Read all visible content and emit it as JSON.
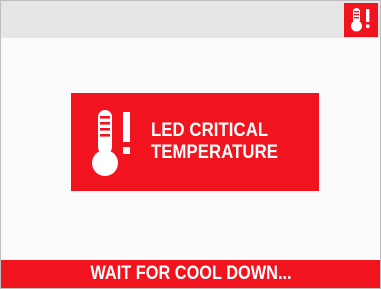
{
  "colors": {
    "alert_red": "#f1141e",
    "topbar_gray": "#e6e6e6",
    "background": "#fbfbfb",
    "text_white": "#ffffff"
  },
  "status_bar": {
    "icon": "thermometer-warning-icon"
  },
  "alert": {
    "icon": "thermometer-warning-icon",
    "line1": "LED CRITICAL",
    "line2": "TEMPERATURE"
  },
  "footer": {
    "message": "WAIT FOR COOL DOWN..."
  }
}
